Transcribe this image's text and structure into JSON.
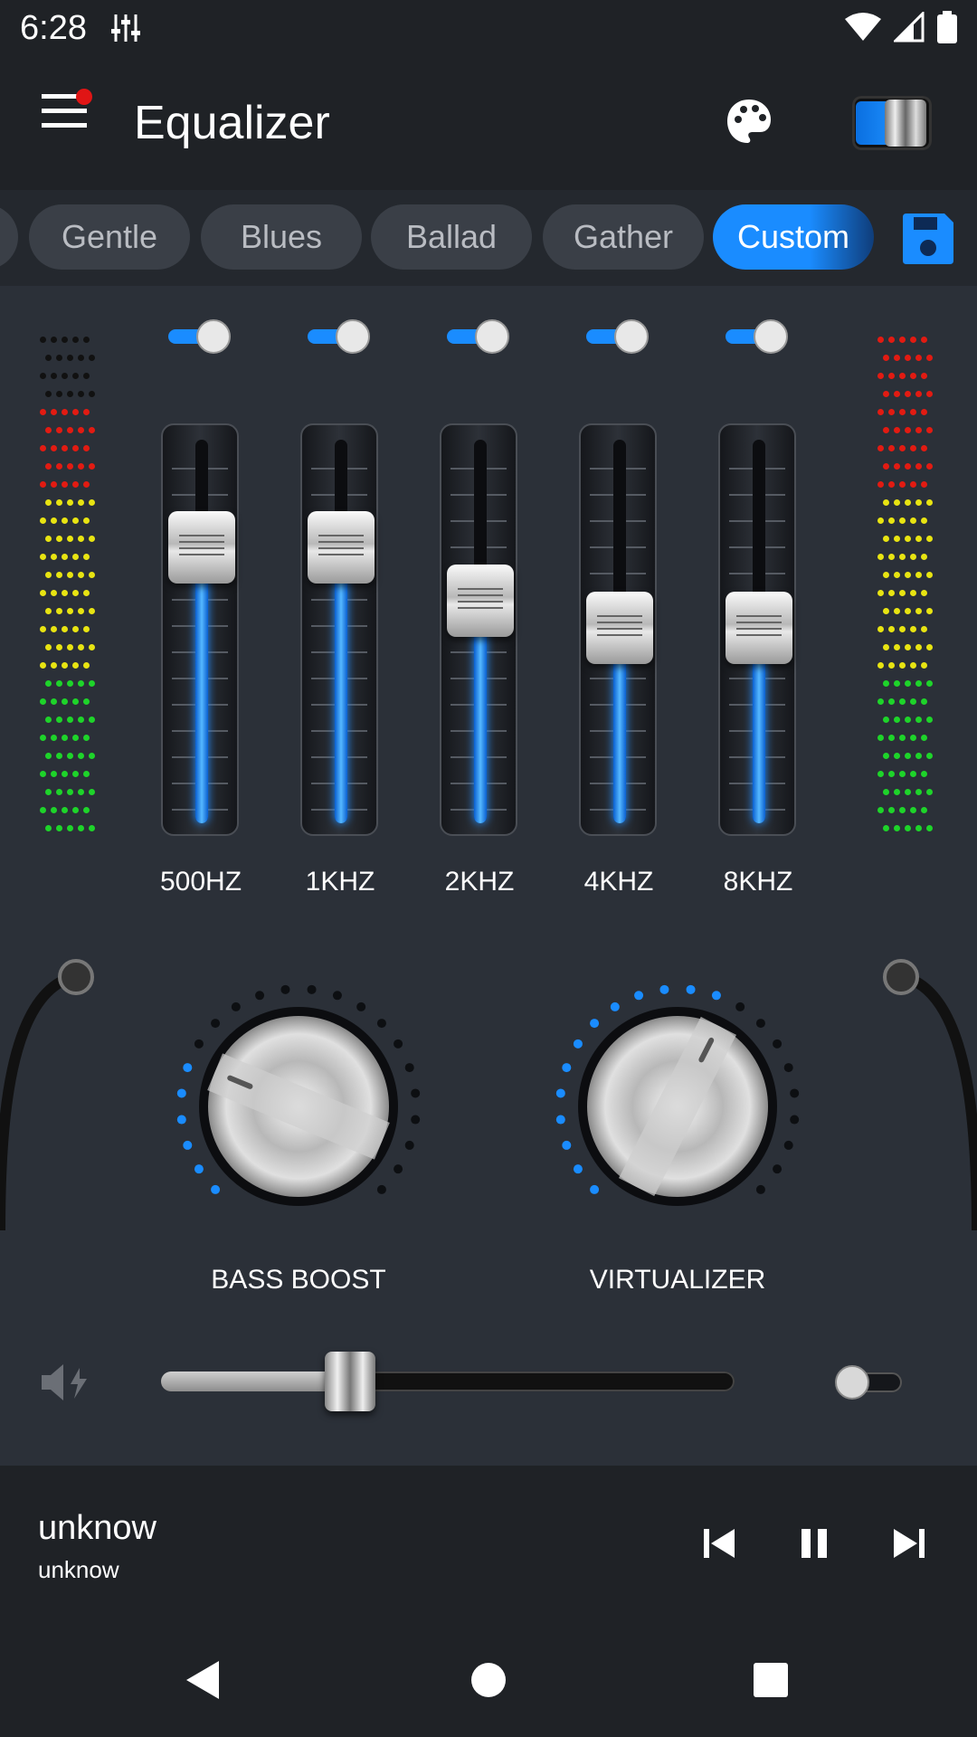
{
  "status_bar": {
    "time": "6:28"
  },
  "app_bar": {
    "title": "Equalizer"
  },
  "presets": [
    "Gentle",
    "Blues",
    "Ballad",
    "Gather",
    "Custom"
  ],
  "active_preset": "Custom",
  "bands": [
    {
      "label": "500HZ",
      "level": 0.72,
      "enabled": true
    },
    {
      "label": "1KHZ",
      "level": 0.72,
      "enabled": true
    },
    {
      "label": "2KHZ",
      "level": 0.58,
      "enabled": true
    },
    {
      "label": "4KHZ",
      "level": 0.51,
      "enabled": true
    },
    {
      "label": "8KHZ",
      "level": 0.51,
      "enabled": true
    }
  ],
  "bass_boost": {
    "label": "BASS BOOST",
    "level": 0.25
  },
  "virtualizer": {
    "label": "VIRTUALIZER",
    "level": 0.6
  },
  "volume_slider": {
    "level": 0.33
  },
  "now_playing": {
    "title": "unknow",
    "artist": "unknow"
  },
  "colors": {
    "accent": "#1a8cff",
    "background": "#2b3038",
    "bar": "#1f2226"
  }
}
